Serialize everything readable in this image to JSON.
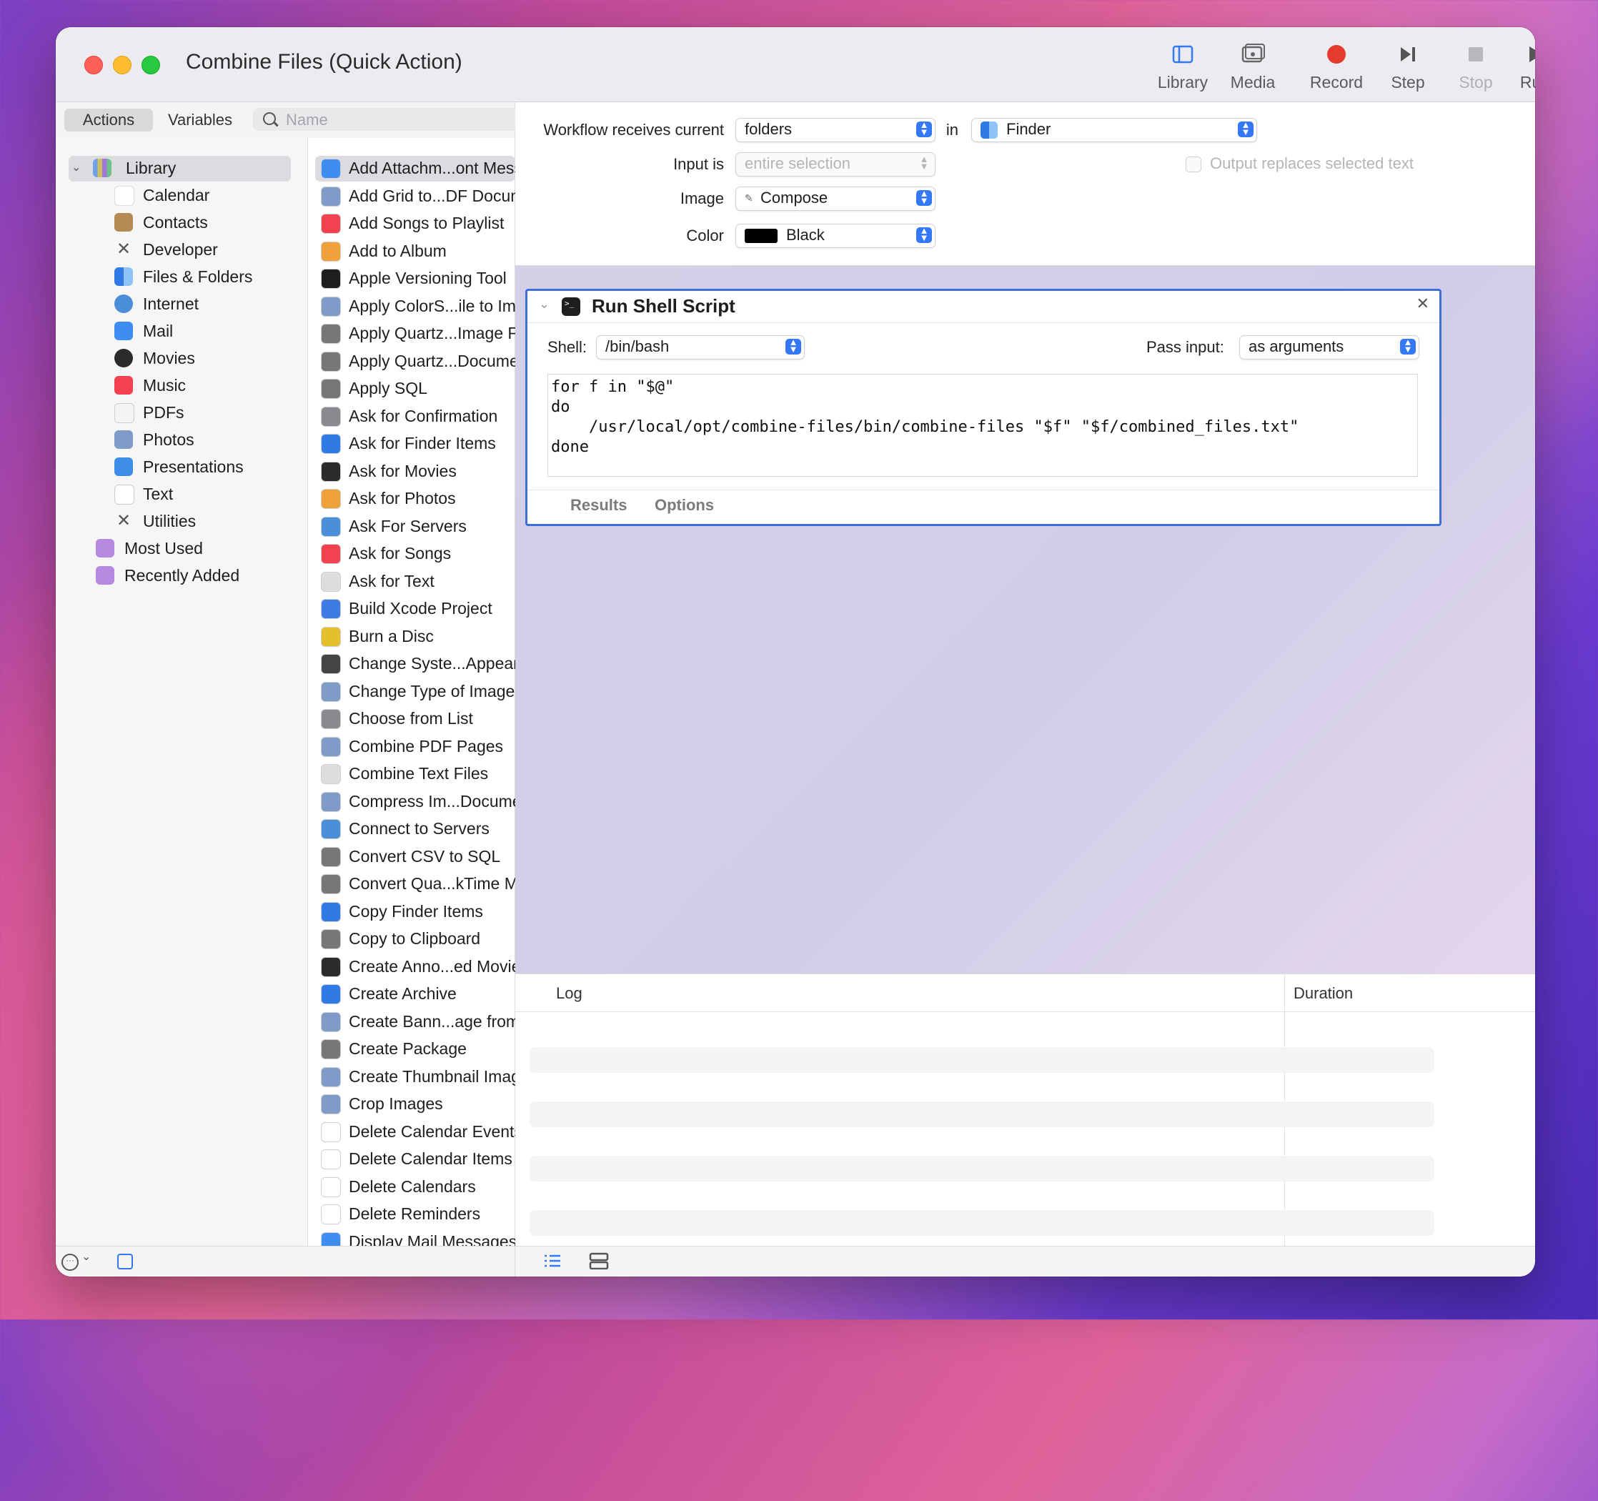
{
  "window": {
    "title": "Combine Files (Quick Action)"
  },
  "toolbar": {
    "library": "Library",
    "media": "Media",
    "record": "Record",
    "step": "Step",
    "stop": "Stop",
    "run": "Run"
  },
  "tabs": {
    "actions": "Actions",
    "variables": "Variables"
  },
  "search": {
    "placeholder": "Name"
  },
  "library": {
    "root": "Library",
    "items": [
      "Calendar",
      "Contacts",
      "Developer",
      "Files & Folders",
      "Internet",
      "Mail",
      "Movies",
      "Music",
      "PDFs",
      "Photos",
      "Presentations",
      "Text",
      "Utilities"
    ],
    "extras": [
      "Most Used",
      "Recently Added"
    ]
  },
  "actions": [
    "Add Attachm...ont Message",
    "Add Grid to...DF Documents",
    "Add Songs to Playlist",
    "Add to Album",
    "Apple Versioning Tool",
    "Apply ColorS...ile to Images",
    "Apply Quartz...Image Files",
    "Apply Quartz...Documents",
    "Apply SQL",
    "Ask for Confirmation",
    "Ask for Finder Items",
    "Ask for Movies",
    "Ask for Photos",
    "Ask For Servers",
    "Ask for Songs",
    "Ask for Text",
    "Build Xcode Project",
    "Burn a Disc",
    "Change Syste...Appearance",
    "Change Type of Images",
    "Choose from List",
    "Combine PDF Pages",
    "Combine Text Files",
    "Compress Im...Documents",
    "Connect to Servers",
    "Convert CSV to SQL",
    "Convert Qua...kTime Movies",
    "Copy Finder Items",
    "Copy to Clipboard",
    "Create Anno...ed Movie File",
    "Create Archive",
    "Create Bann...age from Text",
    "Create Package",
    "Create Thumbnail Images",
    "Crop Images",
    "Delete Calendar Events",
    "Delete Calendar Items",
    "Delete Calendars",
    "Delete Reminders",
    "Display Mail Messages"
  ],
  "config": {
    "receives_label": "Workflow receives current",
    "receives_value": "folders",
    "in_label": "in",
    "in_value": "Finder",
    "input_label": "Input is",
    "input_value": "entire selection",
    "output_replaces": "Output replaces selected text",
    "image_label": "Image",
    "image_value": "Compose",
    "color_label": "Color",
    "color_value": "Black",
    "color_swatch": "#000000"
  },
  "action_box": {
    "title": "Run Shell Script",
    "shell_label": "Shell:",
    "shell_value": "/bin/bash",
    "pass_label": "Pass input:",
    "pass_value": "as arguments",
    "script": "for f in \"$@\"\ndo\n    /usr/local/opt/combine-files/bin/combine-files \"$f\" \"$f/combined_files.txt\"\ndone",
    "tab_results": "Results",
    "tab_options": "Options"
  },
  "log": {
    "col_log": "Log",
    "col_duration": "Duration"
  },
  "colors": {
    "accent": "#3478f6",
    "selected_border": "#3f6fd8"
  }
}
